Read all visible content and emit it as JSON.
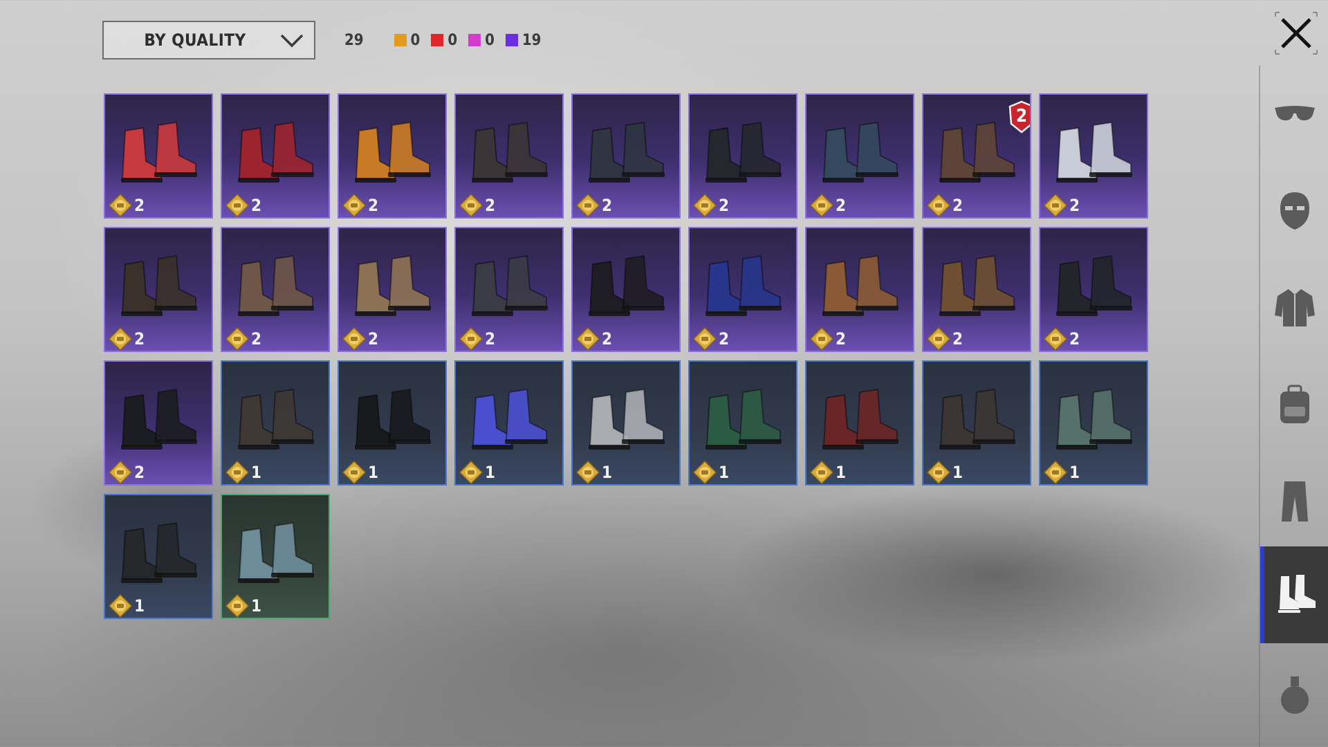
{
  "toolbar": {
    "sort_label": "BY QUALITY",
    "total_count": "29",
    "quality_counts": [
      {
        "color": "#e49a1d",
        "count": "0"
      },
      {
        "color": "#e0262a",
        "count": "0"
      },
      {
        "color": "#d23ad0",
        "count": "0"
      },
      {
        "color": "#6b2fe0",
        "count": "19"
      }
    ]
  },
  "sidebar": {
    "items": [
      {
        "icon": "glasses-icon"
      },
      {
        "icon": "mask-icon"
      },
      {
        "icon": "jacket-icon"
      },
      {
        "icon": "backpack-icon"
      },
      {
        "icon": "pants-icon"
      },
      {
        "icon": "boots-icon",
        "active": true
      },
      {
        "icon": "grenade-icon"
      }
    ]
  },
  "inventory": {
    "items": [
      {
        "quality": "epic",
        "shoe_color": "#c73a3f",
        "coins": "2"
      },
      {
        "quality": "epic",
        "shoe_color": "#9b2430",
        "coins": "2"
      },
      {
        "quality": "epic",
        "shoe_color": "#c97a24",
        "coins": "2"
      },
      {
        "quality": "epic",
        "shoe_color": "#3c3436",
        "coins": "2"
      },
      {
        "quality": "epic",
        "shoe_color": "#2f3542",
        "coins": "2"
      },
      {
        "quality": "epic",
        "shoe_color": "#24272e",
        "coins": "2"
      },
      {
        "quality": "epic",
        "shoe_color": "#34495e",
        "coins": "2"
      },
      {
        "quality": "epic",
        "shoe_color": "#5e4438",
        "coins": "2",
        "badge": "2"
      },
      {
        "quality": "epic",
        "shoe_color": "#c8ccd6",
        "coins": "2"
      },
      {
        "quality": "epic",
        "shoe_color": "#3a312b",
        "coins": "2"
      },
      {
        "quality": "epic",
        "shoe_color": "#6e5648",
        "coins": "2"
      },
      {
        "quality": "epic",
        "shoe_color": "#8d7155",
        "coins": "2"
      },
      {
        "quality": "epic",
        "shoe_color": "#3b3b46",
        "coins": "2"
      },
      {
        "quality": "epic",
        "shoe_color": "#1f1d24",
        "coins": "2"
      },
      {
        "quality": "epic",
        "shoe_color": "#27368a",
        "coins": "2"
      },
      {
        "quality": "epic",
        "shoe_color": "#8a5a36",
        "coins": "2"
      },
      {
        "quality": "epic",
        "shoe_color": "#6e4f33",
        "coins": "2"
      },
      {
        "quality": "epic",
        "shoe_color": "#22252b",
        "coins": "2"
      },
      {
        "quality": "epic",
        "shoe_color": "#1c1d22",
        "coins": "2"
      },
      {
        "quality": "rare",
        "shoe_color": "#3e3835",
        "coins": "1"
      },
      {
        "quality": "rare",
        "shoe_color": "#191a1e",
        "coins": "1"
      },
      {
        "quality": "rare",
        "shoe_color": "#4a4fcf",
        "coins": "1"
      },
      {
        "quality": "rare",
        "shoe_color": "#a9abb1",
        "coins": "1"
      },
      {
        "quality": "rare",
        "shoe_color": "#2c5b44",
        "coins": "1"
      },
      {
        "quality": "rare",
        "shoe_color": "#6a2626",
        "coins": "1"
      },
      {
        "quality": "rare",
        "shoe_color": "#3b3634",
        "coins": "1"
      },
      {
        "quality": "rare",
        "shoe_color": "#56706a",
        "coins": "1"
      },
      {
        "quality": "rare",
        "shoe_color": "#25272b",
        "coins": "1"
      },
      {
        "quality": "uncommon",
        "shoe_color": "#6d8c99",
        "coins": "1"
      }
    ]
  }
}
